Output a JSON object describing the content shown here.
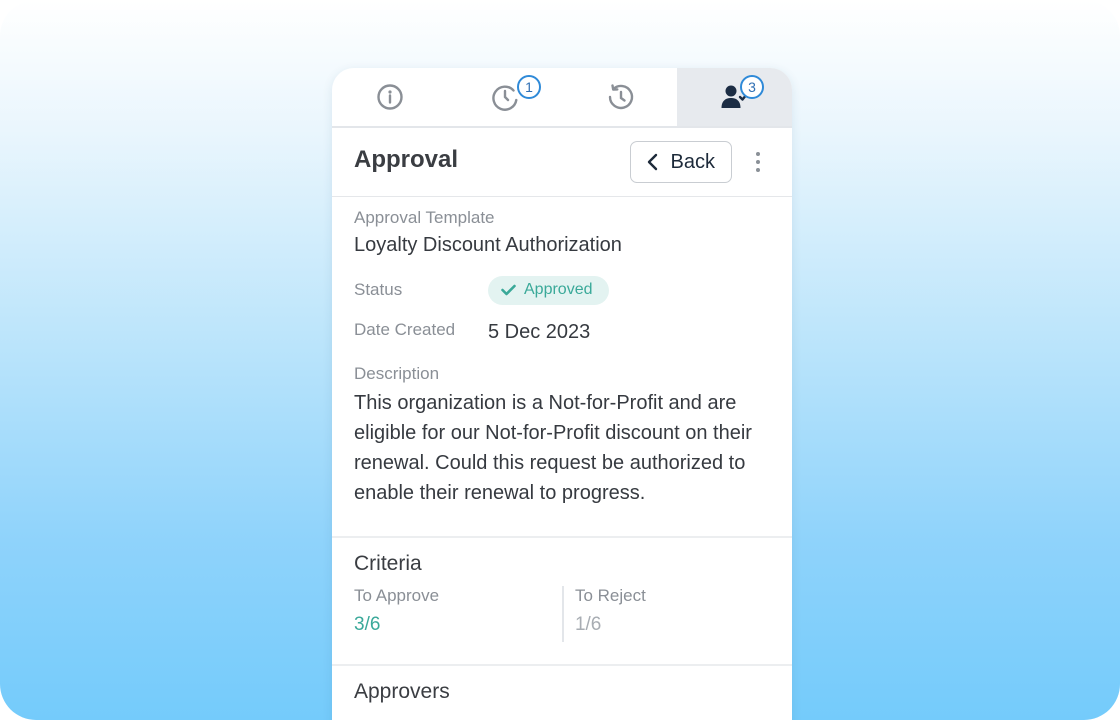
{
  "tabs": [
    {
      "name": "info",
      "icon": "info-icon",
      "badge": ""
    },
    {
      "name": "pending",
      "icon": "clock-icon",
      "badge": "1"
    },
    {
      "name": "history",
      "icon": "history-icon",
      "badge": ""
    },
    {
      "name": "approvers",
      "icon": "user-check-icon",
      "badge": "3",
      "active": true
    }
  ],
  "header": {
    "title": "Approval",
    "back_label": "Back"
  },
  "details": {
    "template_label": "Approval Template",
    "template_value": "Loyalty Discount Authorization",
    "status_label": "Status",
    "status_value": "Approved",
    "date_label": "Date Created",
    "date_value": "5 Dec 2023",
    "description_label": "Description",
    "description_value": "This organization is a Not-for-Profit and are eligible for our Not-for-Profit discount on their renewal. Could this request be authorized to enable their renewal to progress."
  },
  "criteria": {
    "title": "Criteria",
    "approve_label": "To Approve",
    "approve_value": "3/6",
    "reject_label": "To Reject",
    "reject_value": "1/6"
  },
  "approvers": {
    "title": "Approvers"
  },
  "colors": {
    "approved_text": "#3aa999",
    "approved_bg": "#e3f3f1",
    "badge_border": "#2f8ad8"
  }
}
